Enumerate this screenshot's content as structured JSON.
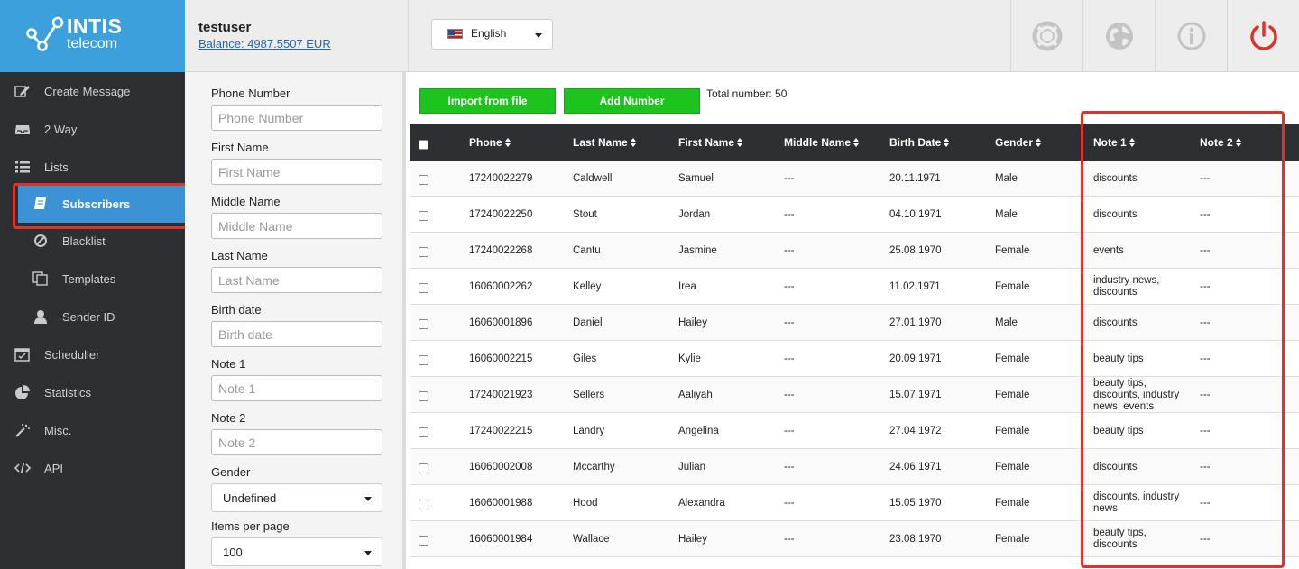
{
  "logo": {
    "brand_line1": "INTIS",
    "brand_line2": "telecom"
  },
  "header": {
    "username": "testuser",
    "balance": "Balance: 4987.5507 EUR",
    "language": "English",
    "icons": [
      "lifebuoy-icon",
      "globe-icon",
      "info-icon",
      "power-icon"
    ]
  },
  "sidebar": {
    "items": [
      {
        "label": "Create Message",
        "icon": "edit-icon"
      },
      {
        "label": "2 Way",
        "icon": "inbox-icon"
      },
      {
        "label": "Lists",
        "icon": "list-icon"
      },
      {
        "label": "Subscribers",
        "icon": "book-icon",
        "active": true
      },
      {
        "label": "Blacklist",
        "icon": "ban-icon"
      },
      {
        "label": "Templates",
        "icon": "copy-icon"
      },
      {
        "label": "Sender ID",
        "icon": "user-icon"
      },
      {
        "label": "Scheduller",
        "icon": "calendar-icon"
      },
      {
        "label": "Statistics",
        "icon": "pie-chart-icon"
      },
      {
        "label": "Misc.",
        "icon": "magic-wand-icon"
      },
      {
        "label": "API",
        "icon": "code-icon"
      }
    ]
  },
  "filter": {
    "phone": {
      "label": "Phone Number",
      "placeholder": "Phone Number"
    },
    "first_name": {
      "label": "First Name",
      "placeholder": "First Name"
    },
    "middle_name": {
      "label": "Middle Name",
      "placeholder": "Middle Name"
    },
    "last_name": {
      "label": "Last Name",
      "placeholder": "Last Name"
    },
    "birth_date": {
      "label": "Birth date",
      "placeholder": "Birth date"
    },
    "note1": {
      "label": "Note 1",
      "placeholder": "Note 1"
    },
    "note2": {
      "label": "Note 2",
      "placeholder": "Note 2"
    },
    "gender": {
      "label": "Gender",
      "value": "Undefined"
    },
    "items_per_page": {
      "label": "Items per page",
      "value": "100"
    }
  },
  "toolbar": {
    "import_label": "Import from file",
    "add_label": "Add Number",
    "total": "Total number: 50"
  },
  "table": {
    "columns": [
      "Phone",
      "Last Name",
      "First Name",
      "Middle Name",
      "Birth Date",
      "Gender",
      "Note 1",
      "Note 2"
    ],
    "rows": [
      [
        "17240022279",
        "Caldwell",
        "Samuel",
        "---",
        "20.11.1971",
        "Male",
        "discounts",
        "---"
      ],
      [
        "17240022250",
        "Stout",
        "Jordan",
        "---",
        "04.10.1971",
        "Male",
        "discounts",
        "---"
      ],
      [
        "17240022268",
        "Cantu",
        "Jasmine",
        "---",
        "25.08.1970",
        "Female",
        "events",
        "---"
      ],
      [
        "16060002262",
        "Kelley",
        "Irea",
        "---",
        "11.02.1971",
        "Female",
        "industry news, discounts",
        "---"
      ],
      [
        "16060001896",
        "Daniel",
        "Hailey",
        "---",
        "27.01.1970",
        "Male",
        "discounts",
        "---"
      ],
      [
        "16060002215",
        "Giles",
        "Kylie",
        "---",
        "20.09.1971",
        "Female",
        "beauty tips",
        "---"
      ],
      [
        "17240021923",
        "Sellers",
        "Aaliyah",
        "---",
        "15.07.1971",
        "Female",
        "beauty tips, discounts, industry news, events",
        "---"
      ],
      [
        "17240022215",
        "Landry",
        "Angelina",
        "---",
        "27.04.1972",
        "Female",
        "beauty tips",
        "---"
      ],
      [
        "16060002008",
        "Mccarthy",
        "Julian",
        "---",
        "24.06.1971",
        "Female",
        "discounts",
        "---"
      ],
      [
        "16060001988",
        "Hood",
        "Alexandra",
        "---",
        "15.05.1970",
        "Female",
        "discounts, industry news",
        "---"
      ],
      [
        "16060001984",
        "Wallace",
        "Hailey",
        "---",
        "23.08.1970",
        "Female",
        "beauty tips, discounts",
        "---"
      ]
    ]
  },
  "colors": {
    "logo_bg": "#3ca0dc",
    "sidebar_bg": "#2e2f33",
    "active_item": "#3b92d4",
    "green_button": "#1ec41e",
    "highlight": "#e0322a",
    "power": "#e0322a"
  }
}
